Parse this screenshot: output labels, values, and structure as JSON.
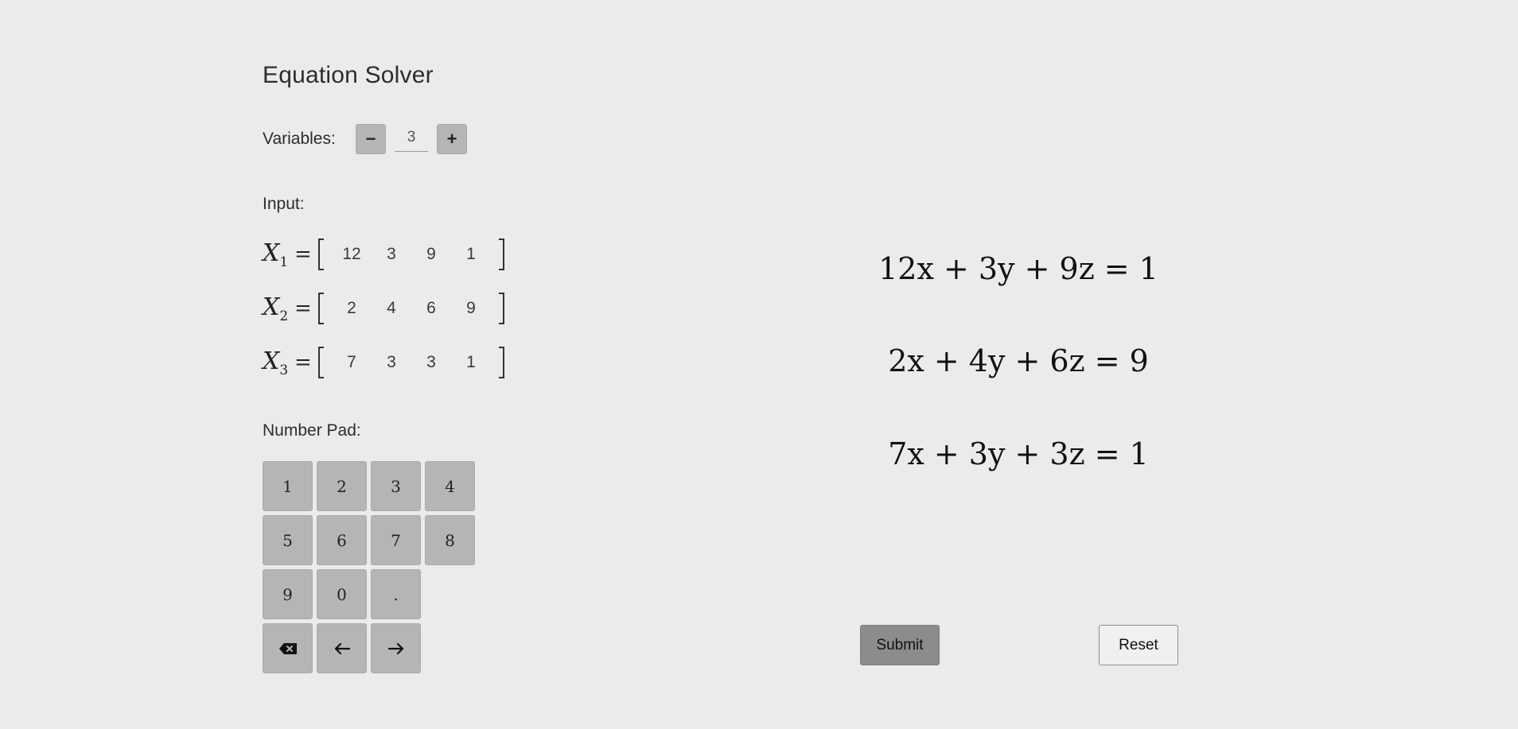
{
  "title": "Equation Solver",
  "variables": {
    "label": "Variables:",
    "decrement_label": "−",
    "value": "3",
    "increment_label": "+"
  },
  "input_label": "Input:",
  "matrix": [
    {
      "name": "X",
      "index": "1",
      "equals": "=",
      "values": [
        "12",
        "3",
        "9",
        "1"
      ]
    },
    {
      "name": "X",
      "index": "2",
      "equals": "=",
      "values": [
        "2",
        "4",
        "6",
        "9"
      ]
    },
    {
      "name": "X",
      "index": "3",
      "equals": "=",
      "values": [
        "7",
        "3",
        "3",
        "1"
      ]
    }
  ],
  "numpad_label": "Number Pad:",
  "numpad_keys": {
    "k1": "1",
    "k2": "2",
    "k3": "3",
    "k4": "4",
    "k5": "5",
    "k6": "6",
    "k7": "7",
    "k8": "8",
    "k9": "9",
    "k0": "0",
    "kdot": ".",
    "backspace_icon": "backspace-icon",
    "left_icon": "arrow-left-icon",
    "right_icon": "arrow-right-icon"
  },
  "equations": [
    "12x + 3y + 9z = 1",
    "2x + 4y + 6z = 9",
    "7x + 3y + 3z = 1"
  ],
  "buttons": {
    "submit": "Submit",
    "reset": "Reset"
  }
}
